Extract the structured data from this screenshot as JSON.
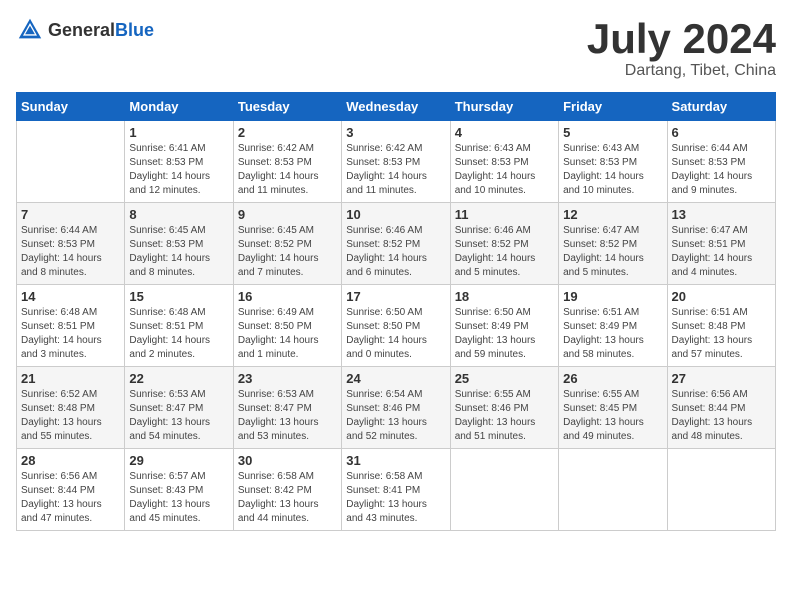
{
  "logo": {
    "text_general": "General",
    "text_blue": "Blue"
  },
  "header": {
    "month_year": "July 2024",
    "location": "Dartang, Tibet, China"
  },
  "weekdays": [
    "Sunday",
    "Monday",
    "Tuesday",
    "Wednesday",
    "Thursday",
    "Friday",
    "Saturday"
  ],
  "weeks": [
    [
      {
        "day": "",
        "content": ""
      },
      {
        "day": "1",
        "content": "Sunrise: 6:41 AM\nSunset: 8:53 PM\nDaylight: 14 hours\nand 12 minutes."
      },
      {
        "day": "2",
        "content": "Sunrise: 6:42 AM\nSunset: 8:53 PM\nDaylight: 14 hours\nand 11 minutes."
      },
      {
        "day": "3",
        "content": "Sunrise: 6:42 AM\nSunset: 8:53 PM\nDaylight: 14 hours\nand 11 minutes."
      },
      {
        "day": "4",
        "content": "Sunrise: 6:43 AM\nSunset: 8:53 PM\nDaylight: 14 hours\nand 10 minutes."
      },
      {
        "day": "5",
        "content": "Sunrise: 6:43 AM\nSunset: 8:53 PM\nDaylight: 14 hours\nand 10 minutes."
      },
      {
        "day": "6",
        "content": "Sunrise: 6:44 AM\nSunset: 8:53 PM\nDaylight: 14 hours\nand 9 minutes."
      }
    ],
    [
      {
        "day": "7",
        "content": "Sunrise: 6:44 AM\nSunset: 8:53 PM\nDaylight: 14 hours\nand 8 minutes."
      },
      {
        "day": "8",
        "content": "Sunrise: 6:45 AM\nSunset: 8:53 PM\nDaylight: 14 hours\nand 8 minutes."
      },
      {
        "day": "9",
        "content": "Sunrise: 6:45 AM\nSunset: 8:52 PM\nDaylight: 14 hours\nand 7 minutes."
      },
      {
        "day": "10",
        "content": "Sunrise: 6:46 AM\nSunset: 8:52 PM\nDaylight: 14 hours\nand 6 minutes."
      },
      {
        "day": "11",
        "content": "Sunrise: 6:46 AM\nSunset: 8:52 PM\nDaylight: 14 hours\nand 5 minutes."
      },
      {
        "day": "12",
        "content": "Sunrise: 6:47 AM\nSunset: 8:52 PM\nDaylight: 14 hours\nand 5 minutes."
      },
      {
        "day": "13",
        "content": "Sunrise: 6:47 AM\nSunset: 8:51 PM\nDaylight: 14 hours\nand 4 minutes."
      }
    ],
    [
      {
        "day": "14",
        "content": "Sunrise: 6:48 AM\nSunset: 8:51 PM\nDaylight: 14 hours\nand 3 minutes."
      },
      {
        "day": "15",
        "content": "Sunrise: 6:48 AM\nSunset: 8:51 PM\nDaylight: 14 hours\nand 2 minutes."
      },
      {
        "day": "16",
        "content": "Sunrise: 6:49 AM\nSunset: 8:50 PM\nDaylight: 14 hours\nand 1 minute."
      },
      {
        "day": "17",
        "content": "Sunrise: 6:50 AM\nSunset: 8:50 PM\nDaylight: 14 hours\nand 0 minutes."
      },
      {
        "day": "18",
        "content": "Sunrise: 6:50 AM\nSunset: 8:49 PM\nDaylight: 13 hours\nand 59 minutes."
      },
      {
        "day": "19",
        "content": "Sunrise: 6:51 AM\nSunset: 8:49 PM\nDaylight: 13 hours\nand 58 minutes."
      },
      {
        "day": "20",
        "content": "Sunrise: 6:51 AM\nSunset: 8:48 PM\nDaylight: 13 hours\nand 57 minutes."
      }
    ],
    [
      {
        "day": "21",
        "content": "Sunrise: 6:52 AM\nSunset: 8:48 PM\nDaylight: 13 hours\nand 55 minutes."
      },
      {
        "day": "22",
        "content": "Sunrise: 6:53 AM\nSunset: 8:47 PM\nDaylight: 13 hours\nand 54 minutes."
      },
      {
        "day": "23",
        "content": "Sunrise: 6:53 AM\nSunset: 8:47 PM\nDaylight: 13 hours\nand 53 minutes."
      },
      {
        "day": "24",
        "content": "Sunrise: 6:54 AM\nSunset: 8:46 PM\nDaylight: 13 hours\nand 52 minutes."
      },
      {
        "day": "25",
        "content": "Sunrise: 6:55 AM\nSunset: 8:46 PM\nDaylight: 13 hours\nand 51 minutes."
      },
      {
        "day": "26",
        "content": "Sunrise: 6:55 AM\nSunset: 8:45 PM\nDaylight: 13 hours\nand 49 minutes."
      },
      {
        "day": "27",
        "content": "Sunrise: 6:56 AM\nSunset: 8:44 PM\nDaylight: 13 hours\nand 48 minutes."
      }
    ],
    [
      {
        "day": "28",
        "content": "Sunrise: 6:56 AM\nSunset: 8:44 PM\nDaylight: 13 hours\nand 47 minutes."
      },
      {
        "day": "29",
        "content": "Sunrise: 6:57 AM\nSunset: 8:43 PM\nDaylight: 13 hours\nand 45 minutes."
      },
      {
        "day": "30",
        "content": "Sunrise: 6:58 AM\nSunset: 8:42 PM\nDaylight: 13 hours\nand 44 minutes."
      },
      {
        "day": "31",
        "content": "Sunrise: 6:58 AM\nSunset: 8:41 PM\nDaylight: 13 hours\nand 43 minutes."
      },
      {
        "day": "",
        "content": ""
      },
      {
        "day": "",
        "content": ""
      },
      {
        "day": "",
        "content": ""
      }
    ]
  ]
}
